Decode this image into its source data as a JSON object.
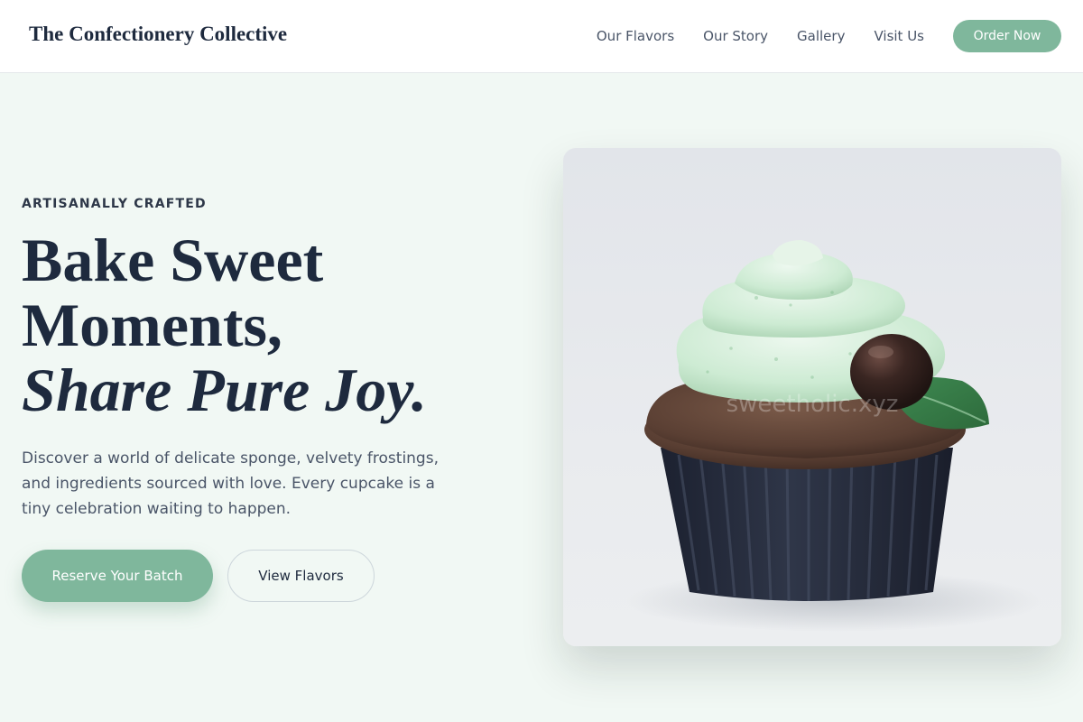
{
  "header": {
    "brand": "The Confectionery Collective",
    "nav": {
      "flavors": "Our Flavors",
      "story": "Our Story",
      "gallery": "Gallery",
      "visit": "Visit Us"
    },
    "cta": "Order Now"
  },
  "hero": {
    "eyebrow": "ARTISANALLY CRAFTED",
    "headline_line1": "Bake Sweet",
    "headline_line2": "Moments,",
    "headline_line3": "Share Pure Joy.",
    "lead": "Discover a world of delicate sponge, velvety frostings, and ingredients sourced with love. Every cupcake is a tiny celebration waiting to happen.",
    "primary_button": "Reserve Your Batch",
    "secondary_button": "View Flavors",
    "image": {
      "watermark": "sweetholic.xyz"
    }
  },
  "colors": {
    "accent": "#7fb79c",
    "background": "#f1f8f4",
    "text": "#1e2a3e"
  }
}
